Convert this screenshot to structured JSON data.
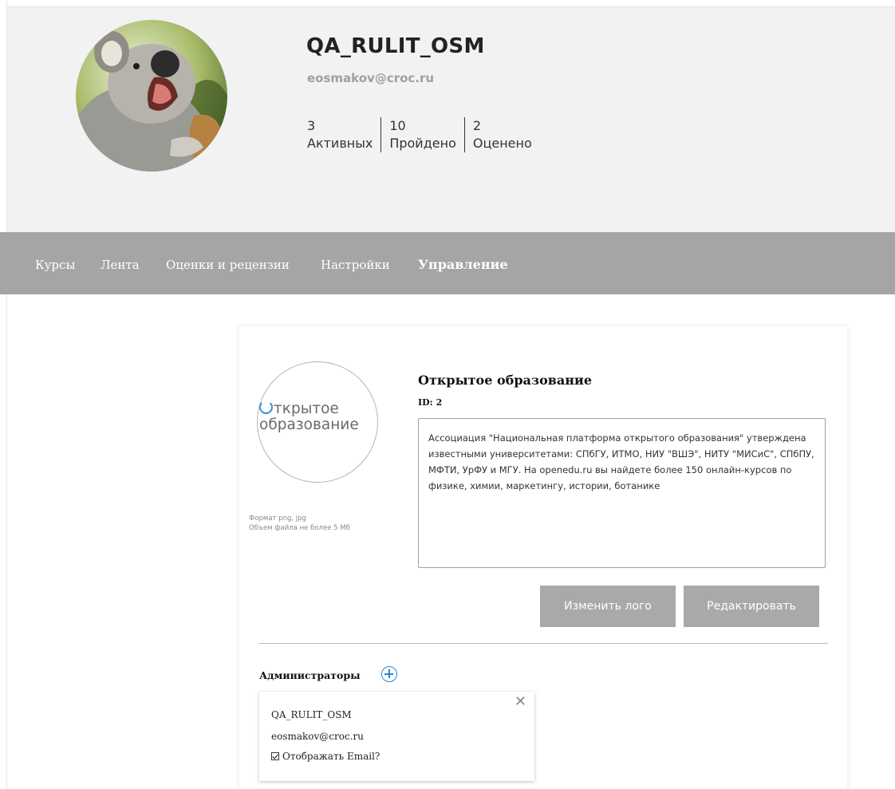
{
  "profile": {
    "username": "QA_RULIT_OSM",
    "email": "eosmakov@croc.ru",
    "stats": [
      {
        "value": "3",
        "label": "Активных"
      },
      {
        "value": "10",
        "label": "Пройдено"
      },
      {
        "value": "2",
        "label": "Оценено"
      }
    ]
  },
  "nav": {
    "courses": "Курсы",
    "feed": "Лента",
    "reviews": "Оценки и рецензии",
    "settings": "Настройки",
    "management": "Управление"
  },
  "org": {
    "logo_line1_rest": "ткрытое",
    "logo_line2": "образование",
    "hint_line1": "Формат png, jpg",
    "hint_line2": "Объем файла не более 5 Мб",
    "title": "Открытое образование",
    "id_label": "ID: 2",
    "description": "Ассоциация \"Национальная платформа открытого образования\" утверждена известными университетами: СПбГУ, ИТМО, НИУ \"ВШЭ\", НИТУ \"МИСиС\", СПбПУ, МФТИ, УрФУ и МГУ. На openedu.ru вы найдете более 150 онлайн-курсов по физике, химии, маркетингу, истории, ботанике",
    "change_logo_label": "Изменить лого",
    "edit_label": "Редактировать"
  },
  "admins": {
    "label": "Администраторы",
    "items": [
      {
        "name": "QA_RULIT_OSM",
        "email": "eosmakov@croc.ru",
        "show_email_label": "Отображать Email?",
        "show_email": true
      }
    ]
  },
  "colors": {
    "nav_bg": "#a5a5a5",
    "header_bg": "#f2f2f2",
    "button_bg": "#a9a9a9",
    "accent": "#2f86d6"
  },
  "icons": [
    "add-admin-icon",
    "close-icon",
    "checkbox-icon"
  ]
}
